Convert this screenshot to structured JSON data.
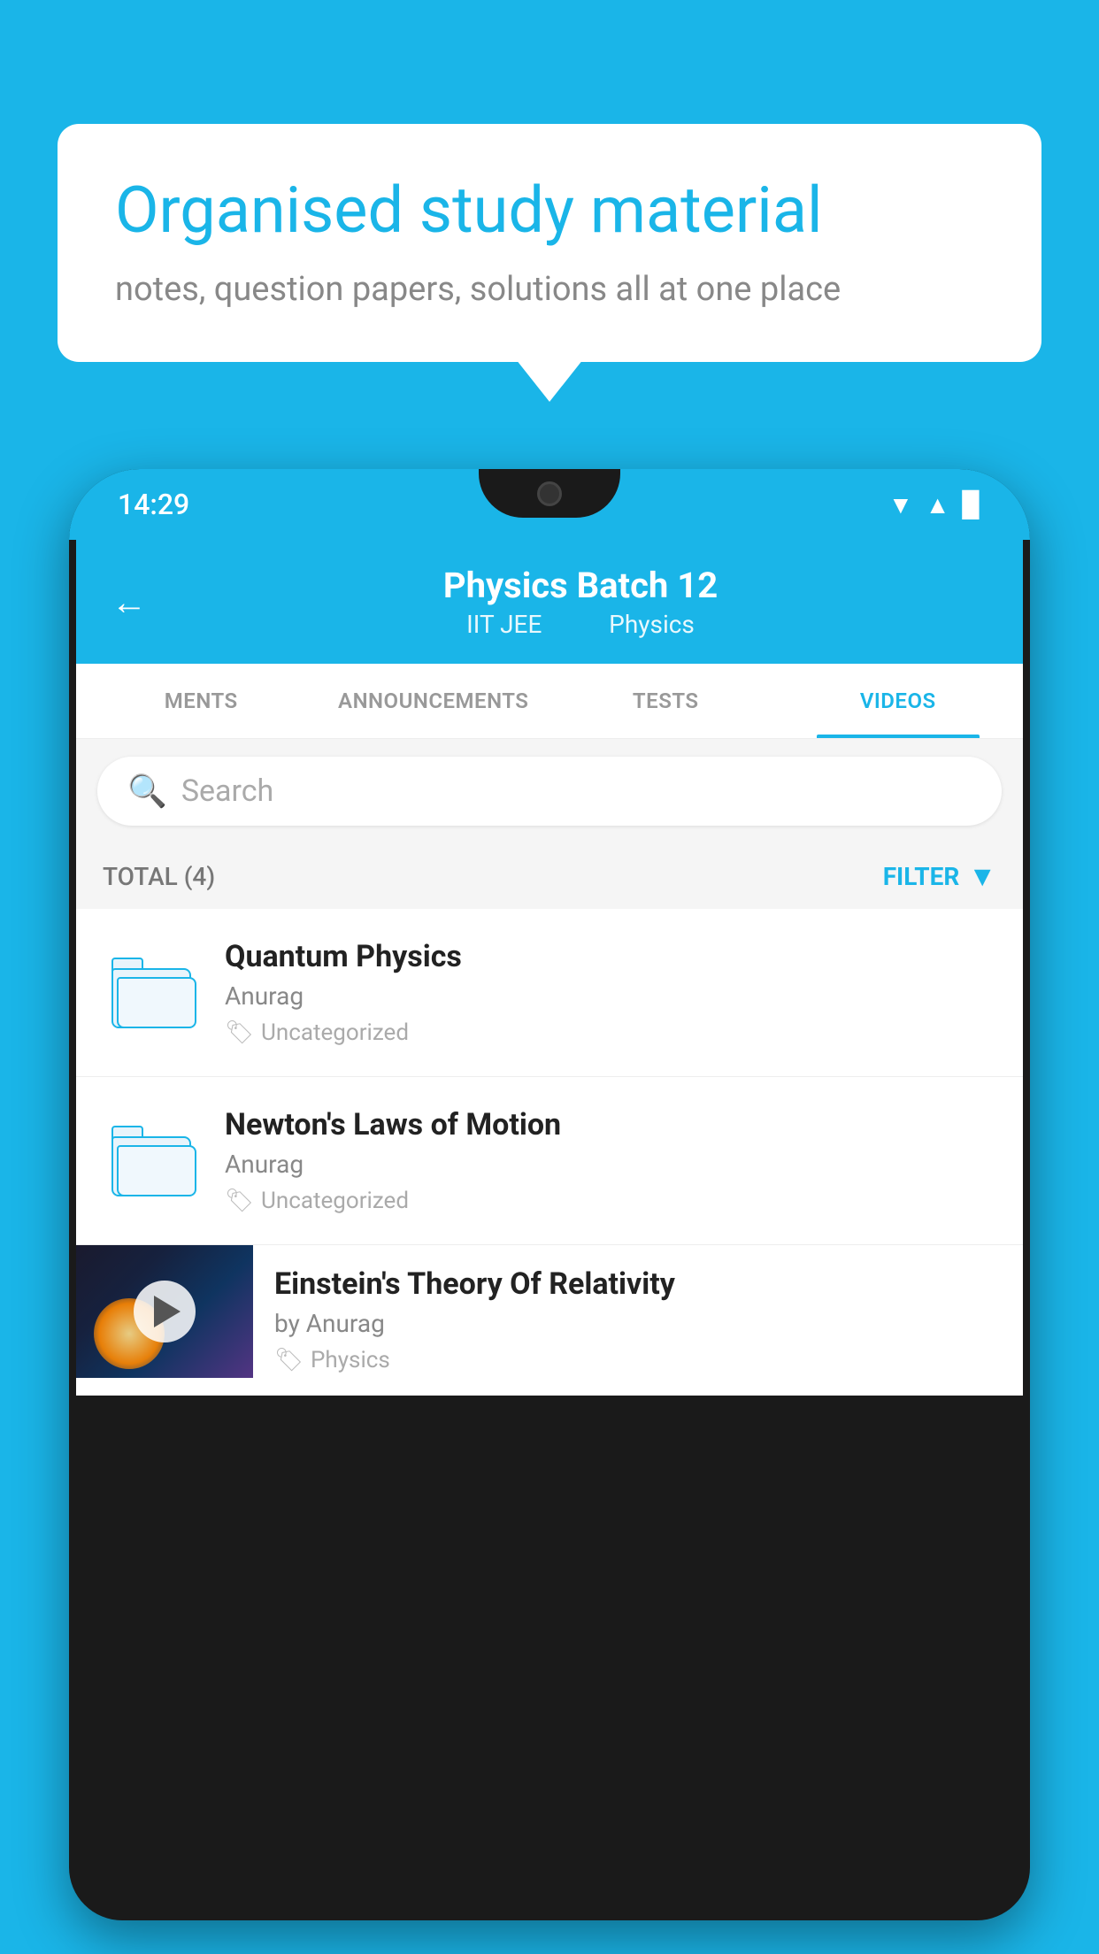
{
  "background": {
    "color": "#1ab5e8"
  },
  "speech_bubble": {
    "title": "Organised study material",
    "subtitle": "notes, question papers, solutions all at one place"
  },
  "phone": {
    "status_bar": {
      "time": "14:29"
    },
    "app_header": {
      "title": "Physics Batch 12",
      "subtitle_part1": "IIT JEE",
      "subtitle_part2": "Physics"
    },
    "tabs": [
      {
        "label": "MENTS",
        "active": false
      },
      {
        "label": "ANNOUNCEMENTS",
        "active": false
      },
      {
        "label": "TESTS",
        "active": false
      },
      {
        "label": "VIDEOS",
        "active": true
      }
    ],
    "search": {
      "placeholder": "Search"
    },
    "filter": {
      "total_label": "TOTAL (4)",
      "filter_label": "FILTER"
    },
    "videos": [
      {
        "title": "Quantum Physics",
        "author": "Anurag",
        "tag": "Uncategorized",
        "has_thumbnail": false
      },
      {
        "title": "Newton's Laws of Motion",
        "author": "Anurag",
        "tag": "Uncategorized",
        "has_thumbnail": false
      },
      {
        "title": "Einstein's Theory Of Relativity",
        "author": "by Anurag",
        "tag": "Physics",
        "has_thumbnail": true
      }
    ]
  }
}
